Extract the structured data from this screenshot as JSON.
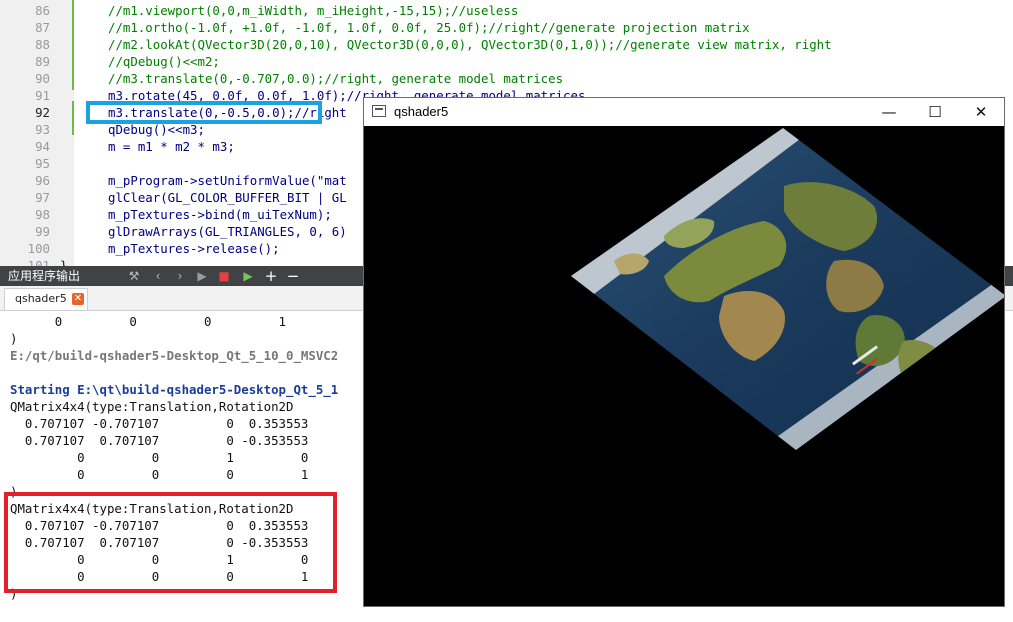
{
  "editor": {
    "lines": [
      {
        "num": "86",
        "text": "//m1.viewport(0,0,m_iWidth, m_iHeight,-15,15);//useless",
        "kind": "comment"
      },
      {
        "num": "87",
        "text": "//m1.ortho(-1.0f, +1.0f, -1.0f, 1.0f, 0.0f, 25.0f);//right//generate projection matrix",
        "kind": "comment"
      },
      {
        "num": "88",
        "text": "//m2.lookAt(QVector3D(20,0,10), QVector3D(0,0,0), QVector3D(0,1,0));//generate view matrix, right",
        "kind": "comment"
      },
      {
        "num": "89",
        "text": "//qDebug()<<m2;",
        "kind": "comment"
      },
      {
        "num": "90",
        "text": "//m3.translate(0,-0.707,0.0);//right, generate model matrices",
        "kind": "comment"
      },
      {
        "num": "91",
        "text": "m3.rotate(45, 0.0f, 0.0f, 1.0f);//right, generate model matrices",
        "kind": "normal"
      },
      {
        "num": "92",
        "text": "m3.translate(0,-0.5,0.0);//right",
        "kind": "normal"
      },
      {
        "num": "93",
        "text": "qDebug()<<m3;",
        "kind": "normal"
      },
      {
        "num": "94",
        "text": "m = m1 * m2 * m3;",
        "kind": "normal"
      },
      {
        "num": "95",
        "text": "",
        "kind": "normal"
      },
      {
        "num": "96",
        "text": "m_pProgram->setUniformValue(\"mat",
        "kind": "normal"
      },
      {
        "num": "97",
        "text": "glClear(GL_COLOR_BUFFER_BIT | GL",
        "kind": "normal"
      },
      {
        "num": "98",
        "text": "m_pTextures->bind(m_uiTexNum);",
        "kind": "normal"
      },
      {
        "num": "99",
        "text": "glDrawArrays(GL_TRIANGLES, 0, 6)",
        "kind": "normal"
      },
      {
        "num": "100",
        "text": "m_pTextures->release();",
        "kind": "normal"
      },
      {
        "num": "101",
        "text": "}",
        "kind": "normal"
      }
    ]
  },
  "output_pane": {
    "title": "应用程序输出",
    "tab_label": "qshader5",
    "tab_close": "✕",
    "toolbar_icons": [
      "build-icon",
      "prev-icon",
      "next-icon",
      "run-icon",
      "stop-icon",
      "attach-icon",
      "zoom-in-icon",
      "zoom-out-icon"
    ],
    "lines": [
      {
        "text": "      0         0         0         1",
        "kind": "plain"
      },
      {
        "text": ")",
        "kind": "plain"
      },
      {
        "text": "E:/qt/build-qshader5-Desktop_Qt_5_10_0_MSVC2",
        "kind": "gray"
      },
      {
        "text": "",
        "kind": "plain"
      },
      {
        "text": "Starting E:\\qt\\build-qshader5-Desktop_Qt_5_1",
        "kind": "blue"
      },
      {
        "text": "QMatrix4x4(type:Translation,Rotation2D",
        "kind": "plain"
      },
      {
        "text": "  0.707107 -0.707107         0  0.353553",
        "kind": "plain"
      },
      {
        "text": "  0.707107  0.707107         0 -0.353553",
        "kind": "plain"
      },
      {
        "text": "         0         0         1         0",
        "kind": "plain"
      },
      {
        "text": "         0         0         0         1",
        "kind": "plain"
      },
      {
        "text": ")",
        "kind": "plain"
      },
      {
        "text": "QMatrix4x4(type:Translation,Rotation2D",
        "kind": "plain"
      },
      {
        "text": "  0.707107 -0.707107         0  0.353553",
        "kind": "plain"
      },
      {
        "text": "  0.707107  0.707107         0 -0.353553",
        "kind": "plain"
      },
      {
        "text": "         0         0         1         0",
        "kind": "plain"
      },
      {
        "text": "         0         0         0         1",
        "kind": "plain"
      },
      {
        "text": ")",
        "kind": "plain"
      }
    ]
  },
  "window": {
    "title": "qshader5",
    "minimize": "—",
    "maximize": "☐",
    "close": "✕"
  },
  "colors": {
    "highlight_blue": "#1aa3e0",
    "highlight_red": "#e0202a",
    "toolbar_bg": "#404244",
    "ocean": "#1d3f63"
  }
}
